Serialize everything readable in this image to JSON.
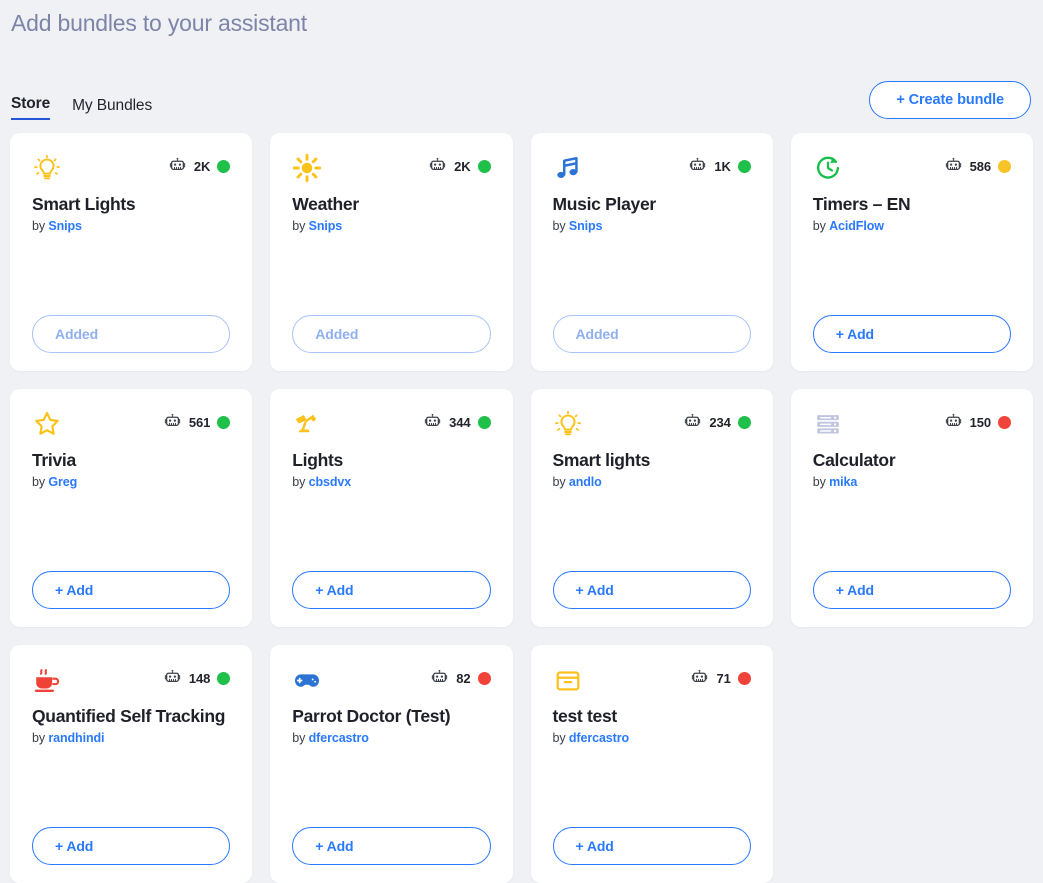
{
  "header": {
    "title": "Add bundles to your assistant",
    "create_button": "+ Create bundle"
  },
  "tabs": [
    {
      "label": "Store",
      "active": true
    },
    {
      "label": "My Bundles",
      "active": false
    }
  ],
  "labels": {
    "by_prefix": "by ",
    "add": "+ Add",
    "added": "Added"
  },
  "colors": {
    "accent_blue": "#2979ff",
    "added_blue": "#8fb0f0",
    "status_green": "#1ec04a",
    "status_yellow": "#f7c325",
    "status_red": "#f0433a",
    "icon_yellow": "#fcc21b",
    "icon_blue": "#2b74d4",
    "icon_green": "#14c04a",
    "icon_red": "#ef4136",
    "background": "#f0f1f5"
  },
  "cards": [
    {
      "name": "Smart Lights",
      "author": "Snips",
      "count": "2K",
      "status": "green",
      "action": "added",
      "icon": "lightbulb-icon"
    },
    {
      "name": "Weather",
      "author": "Snips",
      "count": "2K",
      "status": "green",
      "action": "added",
      "icon": "sun-icon"
    },
    {
      "name": "Music Player",
      "author": "Snips",
      "count": "1K",
      "status": "green",
      "action": "added",
      "icon": "music-note-icon"
    },
    {
      "name": "Timers – EN",
      "author": "AcidFlow",
      "count": "586",
      "status": "yellow",
      "action": "add",
      "icon": "timer-icon"
    },
    {
      "name": "Trivia",
      "author": "Greg",
      "count": "561",
      "status": "green",
      "action": "add",
      "icon": "star-icon"
    },
    {
      "name": "Lights",
      "author": "cbsdvx",
      "count": "344",
      "status": "green",
      "action": "add",
      "icon": "desk-lamp-icon"
    },
    {
      "name": "Smart lights",
      "author": "andlo",
      "count": "234",
      "status": "green",
      "action": "add",
      "icon": "lightbulb-icon"
    },
    {
      "name": "Calculator",
      "author": "mika",
      "count": "150",
      "status": "red",
      "action": "add",
      "icon": "server-stack-icon"
    },
    {
      "name": "Quantified Self Tracking",
      "author": "randhindi",
      "count": "148",
      "status": "green",
      "action": "add",
      "icon": "coffee-cup-icon"
    },
    {
      "name": "Parrot Doctor (Test)",
      "author": "dfercastro",
      "count": "82",
      "status": "red",
      "action": "add",
      "icon": "gamepad-icon"
    },
    {
      "name": "test test",
      "author": "dfercastro",
      "count": "71",
      "status": "red",
      "action": "add",
      "icon": "box-icon"
    }
  ]
}
